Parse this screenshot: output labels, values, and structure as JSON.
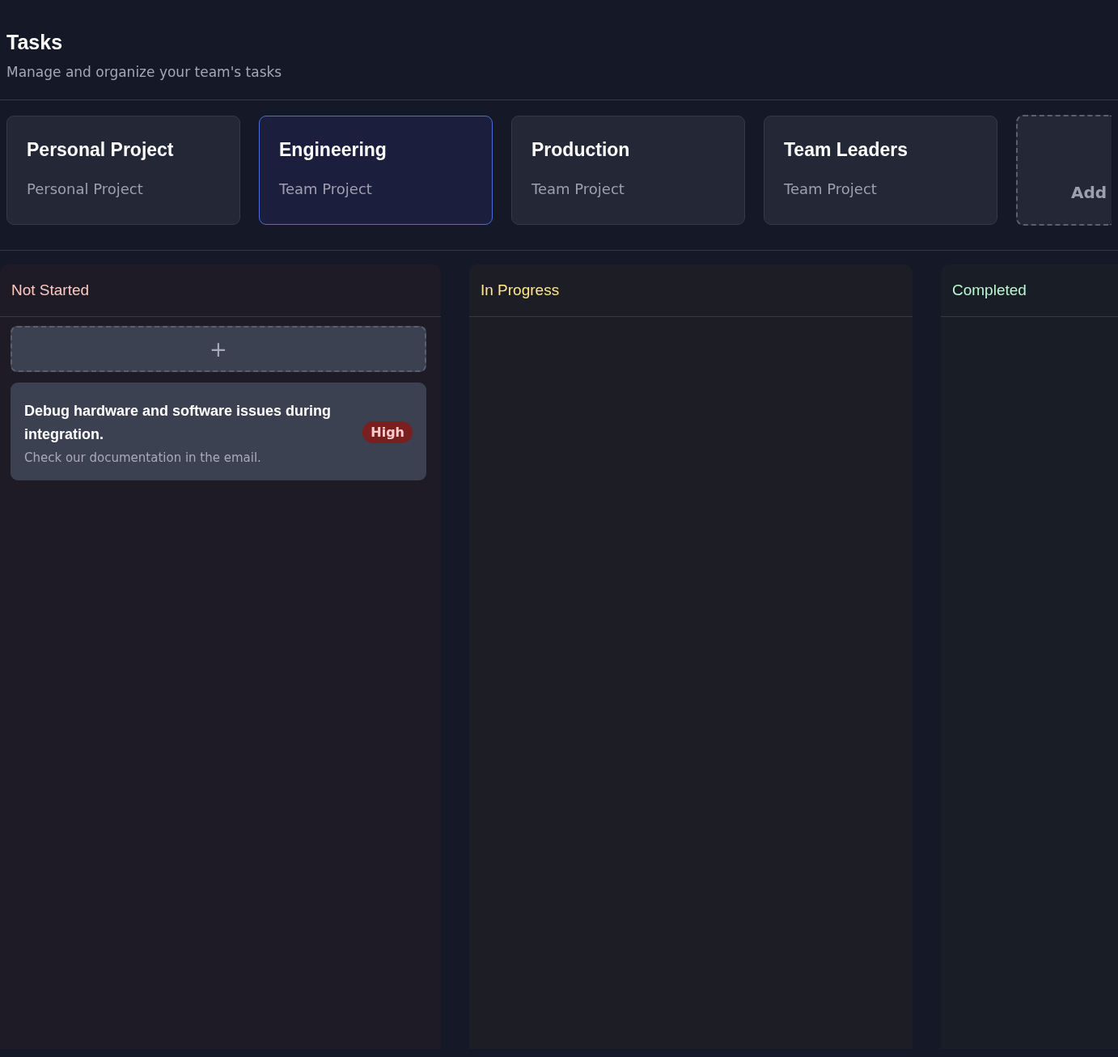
{
  "header": {
    "title": "Tasks",
    "subtitle": "Manage and organize your team's tasks"
  },
  "projects": [
    {
      "name": "Personal Project",
      "type": "Personal Project",
      "selected": false
    },
    {
      "name": "Engineering",
      "type": "Team Project",
      "selected": true
    },
    {
      "name": "Production",
      "type": "Team Project",
      "selected": false
    },
    {
      "name": "Team Leaders",
      "type": "Team Project",
      "selected": false
    }
  ],
  "add_project": {
    "label": "Add"
  },
  "columns": [
    {
      "title": "Not Started",
      "color": "#f9c9c0",
      "add_button": {
        "label": "+"
      },
      "tasks": [
        {
          "title": "Debug hardware and software issues during integration.",
          "description": "Check our documentation in the email.",
          "priority": "High"
        }
      ]
    },
    {
      "title": "In Progress",
      "color": "#fde68a"
    },
    {
      "title": "Completed",
      "color": "#bbf7d0"
    }
  ]
}
